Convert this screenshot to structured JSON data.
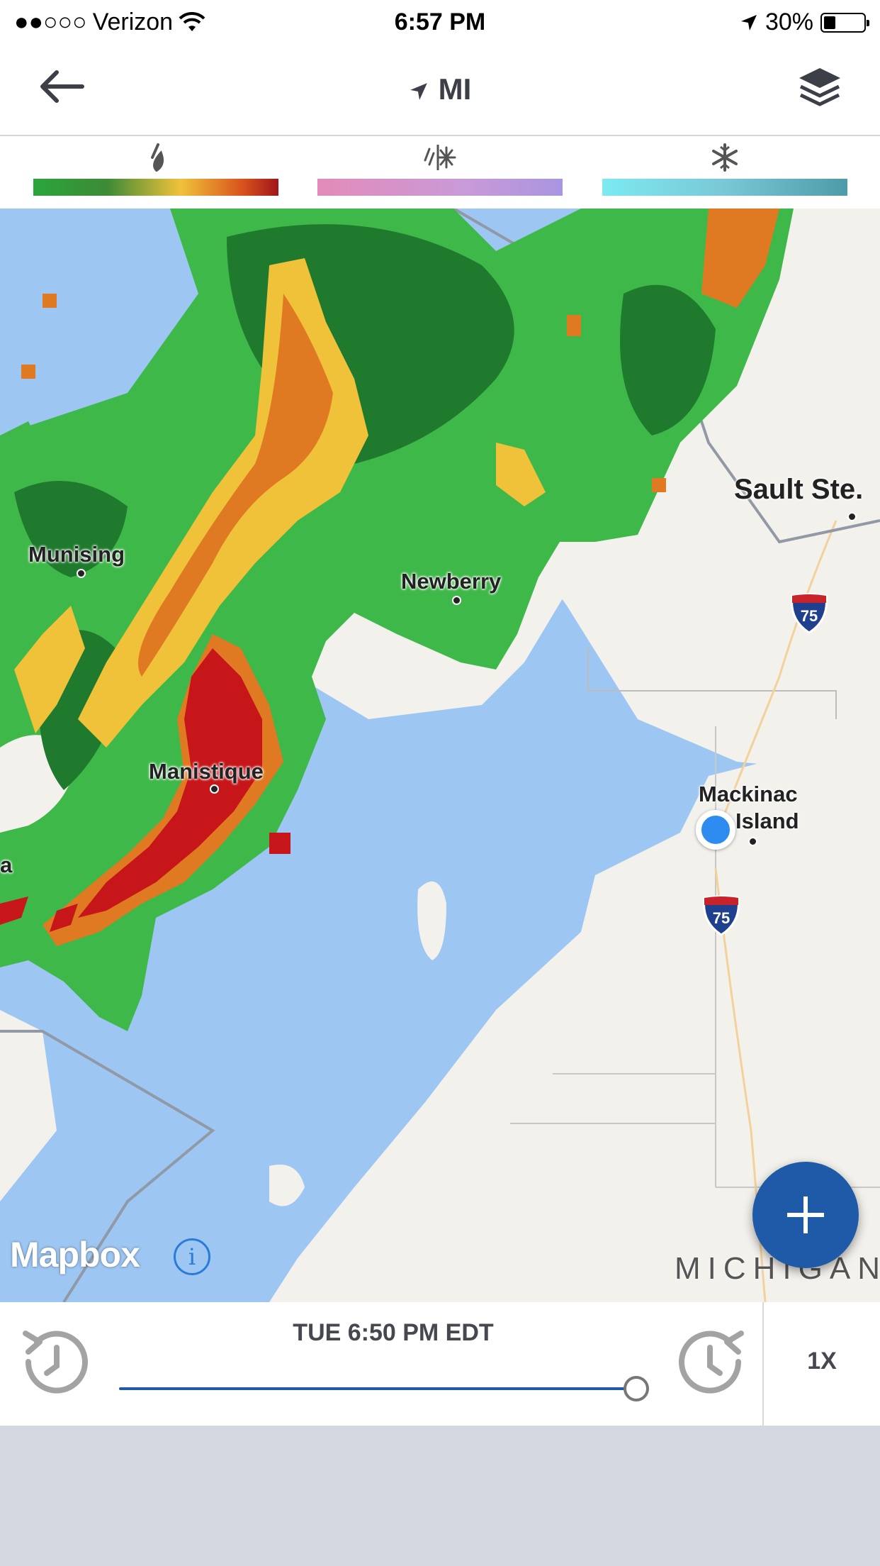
{
  "status_bar": {
    "signal": "●●○○○",
    "carrier": "Verizon",
    "time": "6:57 PM",
    "battery": "30%",
    "battery_level": 0.3
  },
  "header": {
    "title": "MI",
    "icons": {
      "back": "arrow-left-icon",
      "location": "location-arrow-icon",
      "layers": "layers-icon"
    }
  },
  "legend": [
    {
      "name": "rain",
      "icon": "raindrop-icon",
      "glyph": "⁄"
    },
    {
      "name": "mix",
      "icon": "rain-snow-mix-icon",
      "glyph": "⁄⁄❄"
    },
    {
      "name": "snow",
      "icon": "snowflake-icon",
      "glyph": "❄"
    }
  ],
  "map": {
    "labels": {
      "munising": "Munising",
      "newberry": "Newberry",
      "sault": "Sault Ste.",
      "manistique": "Manistique",
      "mackinac_1": "Mackinac",
      "mackinac_2": "Island",
      "left_edge": "a",
      "state": "MICHIGAN"
    },
    "shields": [
      "75",
      "75"
    ],
    "attribution": "Mapbox",
    "info": "i",
    "colors": {
      "water": "#9dc6f2",
      "land": "#f3f1ec",
      "radar_green": "#3fb84a",
      "radar_dark_green": "#1f7a2d",
      "radar_yellow": "#f0c23a",
      "radar_orange": "#e07a22",
      "radar_red": "#c7161a",
      "accent_blue": "#1f5aa8"
    }
  },
  "playback": {
    "time": "TUE 6:50 PM EDT",
    "speed": "1X",
    "progress": 1.0
  }
}
